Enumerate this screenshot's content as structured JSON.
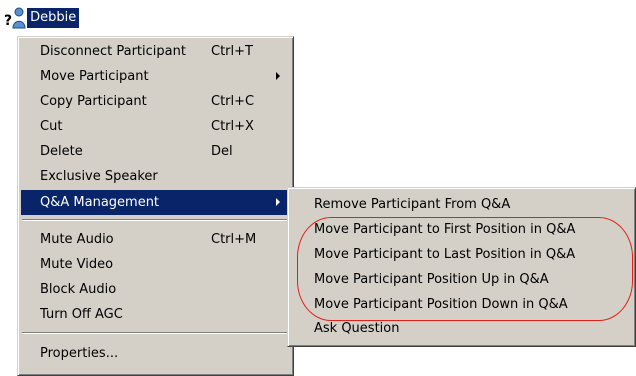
{
  "participant": {
    "status_icon": "question-mark-icon",
    "person_icon": "person-icon",
    "name": "Debbie",
    "status_mark": "?"
  },
  "context_menu": {
    "items": [
      {
        "label": "Disconnect Participant",
        "shortcut": "Ctrl+T"
      },
      {
        "label": "Move Participant",
        "shortcut": "",
        "submenu": true
      },
      {
        "label": "Copy Participant",
        "shortcut": "Ctrl+C"
      },
      {
        "label": "Cut",
        "shortcut": "Ctrl+X"
      },
      {
        "label": "Delete",
        "shortcut": "Del"
      },
      {
        "label": "Exclusive Speaker",
        "shortcut": ""
      },
      {
        "label": "Q&A Management",
        "shortcut": "",
        "submenu": true,
        "active": true
      },
      {
        "label": "Mute Audio",
        "shortcut": "Ctrl+M"
      },
      {
        "label": "Mute Video",
        "shortcut": ""
      },
      {
        "label": "Block Audio",
        "shortcut": ""
      },
      {
        "label": "Turn Off AGC",
        "shortcut": ""
      },
      {
        "label": "Properties...",
        "shortcut": ""
      }
    ]
  },
  "qa_submenu": {
    "items": [
      {
        "label": "Remove Participant From Q&A"
      },
      {
        "label": "Move Participant to First Position in Q&A"
      },
      {
        "label": "Move Participant to Last Position in Q&A"
      },
      {
        "label": "Move Participant Position Up in Q&A"
      },
      {
        "label": "Move Participant Position Down in Q&A"
      },
      {
        "label": "Ask Question"
      }
    ]
  },
  "colors": {
    "menu_background": "#d4d0c8",
    "highlight": "#0a246a",
    "annotation": "#e0201a"
  }
}
